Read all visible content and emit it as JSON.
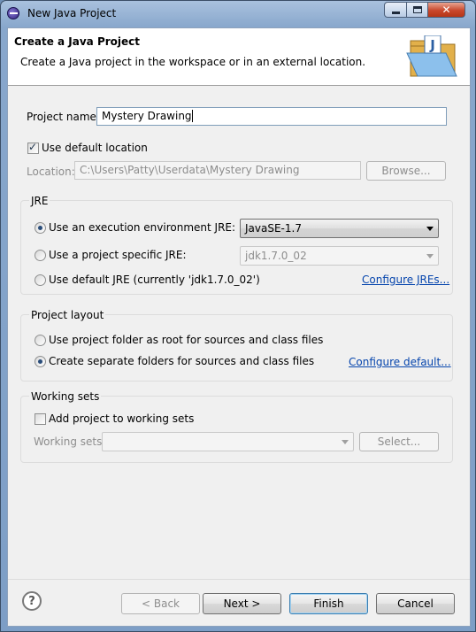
{
  "window": {
    "title": "New Java Project"
  },
  "header": {
    "title": "Create a Java Project",
    "description": "Create a Java project in the workspace or in an external location."
  },
  "project": {
    "name_label": "Project name:",
    "name_value": "Mystery Drawing",
    "use_default_location_label": "Use default location",
    "use_default_location_checked": true,
    "location_label": "Location:",
    "location_value": "C:\\Users\\Patty\\Userdata\\Mystery Drawing",
    "browse_label": "Browse..."
  },
  "jre": {
    "legend": "JRE",
    "option_env_label": "Use an execution environment JRE:",
    "option_env_value": "JavaSE-1.7",
    "option_specific_label": "Use a project specific JRE:",
    "option_specific_value": "jdk1.7.0_02",
    "option_default_label": "Use default JRE (currently 'jdk1.7.0_02')",
    "configure_link": "Configure JREs...",
    "selected": "execution environment"
  },
  "layout": {
    "legend": "Project layout",
    "option_root_label": "Use project folder as root for sources and class files",
    "option_separate_label": "Create separate folders for sources and class files",
    "configure_link": "Configure default...",
    "selected": "separate folders"
  },
  "working_sets": {
    "legend": "Working sets",
    "add_label": "Add project to working sets",
    "add_checked": false,
    "sets_label": "Working sets:",
    "sets_value": "",
    "select_label": "Select..."
  },
  "footer": {
    "back_label": "< Back",
    "next_label": "Next >",
    "finish_label": "Finish",
    "cancel_label": "Cancel"
  },
  "icons": {
    "app": "eclipse-icon",
    "wizard": "java-folder-icon",
    "help": "help-icon"
  },
  "colors": {
    "link": "#0645ad",
    "accent": "#3c7fb1"
  }
}
